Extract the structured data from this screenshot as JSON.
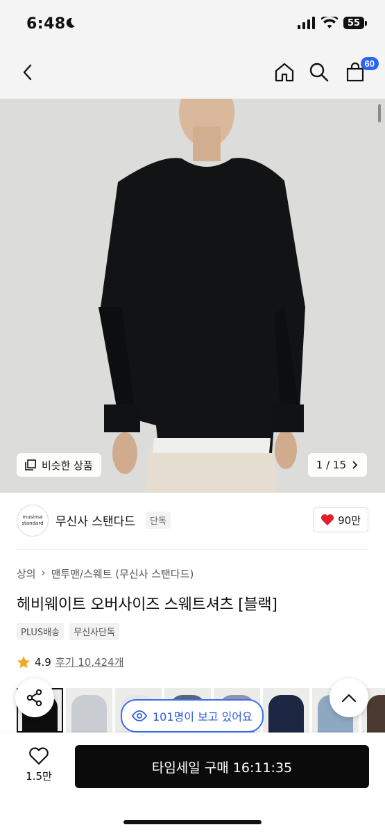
{
  "status_bar": {
    "time": "6:48",
    "battery": "55"
  },
  "header": {
    "cart_count": "60"
  },
  "gallery": {
    "similar_label": "비슷한 상품",
    "page_indicator": "1 / 15"
  },
  "brand": {
    "logo_line1": "musinsa",
    "logo_line2": "standard",
    "name": "무신사 스탠다드",
    "exclusive_tag": "단독",
    "like_count": "90만"
  },
  "breadcrumb": {
    "root": "상의",
    "category": "맨투맨/스웨트 (무신사 스탠다드)"
  },
  "product": {
    "title": "헤비웨이트 오버사이즈 스웨트셔츠 [블랙]",
    "tags": [
      "PLUS배송",
      "무신사단독"
    ],
    "rating": "4.9",
    "reviews": "후기 10,424개"
  },
  "variants": [
    {
      "color": "#0d0d0d"
    },
    {
      "color": "#c9ccd1"
    },
    {
      "color": "#e6e6e6"
    },
    {
      "color": "#56657a"
    },
    {
      "color": "#8a96a6"
    },
    {
      "color": "#1d2642"
    },
    {
      "color": "#8fa8c2"
    },
    {
      "color": "#4a3a30"
    }
  ],
  "viewers": {
    "text": "101명이 보고 있어요"
  },
  "bottom_bar": {
    "wishlist_count": "1.5만",
    "buy_label": "타임세일 구매 16:11:35"
  },
  "colors": {
    "accent": "#2a63f6",
    "like": "#e02030",
    "star": "#f5a623",
    "buy_bg": "#0b0b0b"
  }
}
